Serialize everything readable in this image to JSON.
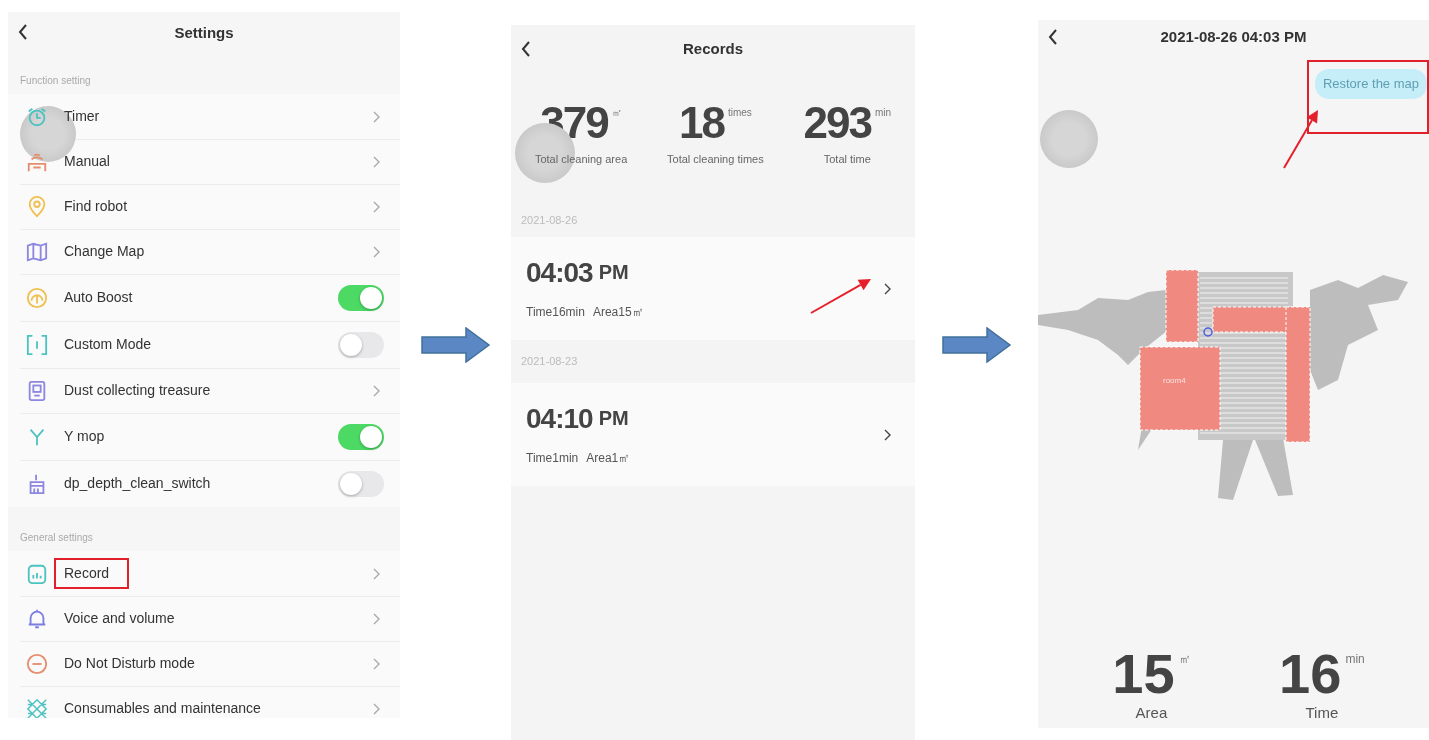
{
  "settings": {
    "title": "Settings",
    "sections": [
      {
        "header": "Function setting",
        "items": [
          {
            "label": "Timer",
            "kind": "link",
            "highlighted": false
          },
          {
            "label": "Manual",
            "kind": "link",
            "highlighted": false
          },
          {
            "label": "Find robot",
            "kind": "link",
            "highlighted": false
          },
          {
            "label": "Change Map",
            "kind": "link",
            "highlighted": false
          },
          {
            "label": "Auto Boost",
            "kind": "toggle",
            "on": true,
            "highlighted": false
          },
          {
            "label": "Custom Mode",
            "kind": "toggle",
            "on": false,
            "highlighted": false
          },
          {
            "label": "Dust collecting treasure",
            "kind": "link",
            "highlighted": false
          },
          {
            "label": "Y mop",
            "kind": "toggle",
            "on": true,
            "highlighted": false
          },
          {
            "label": "dp_depth_clean_switch",
            "kind": "toggle",
            "on": false,
            "highlighted": false
          }
        ]
      },
      {
        "header": "General settings",
        "items": [
          {
            "label": "Record",
            "kind": "link",
            "highlighted": true
          },
          {
            "label": "Voice and volume",
            "kind": "link",
            "highlighted": false
          },
          {
            "label": "Do Not Disturb mode",
            "kind": "link",
            "highlighted": false
          },
          {
            "label": "Consumables and maintenance",
            "kind": "link",
            "highlighted": false
          }
        ]
      }
    ]
  },
  "records": {
    "title": "Records",
    "stats": [
      {
        "value": "379",
        "unit": "㎡",
        "label": "Total cleaning area"
      },
      {
        "value": "18",
        "unit": "times",
        "label": "Total cleaning times"
      },
      {
        "value": "293",
        "unit": "min",
        "label": "Total time"
      }
    ],
    "entries": [
      {
        "date": "2021-08-26",
        "time": "04:03",
        "period": "PM",
        "duration": "Time16min",
        "area": "Area15㎡",
        "pointed": true
      },
      {
        "date": "2021-08-23",
        "time": "04:10",
        "period": "PM",
        "duration": "Time1min",
        "area": "Area1㎡",
        "pointed": false
      }
    ]
  },
  "record_detail": {
    "title": "2021-08-26 04:03 PM",
    "restore_button": {
      "label": "Restore the map",
      "disabled": true,
      "highlighted": true
    },
    "map": {
      "room_label": "room4"
    },
    "stats": [
      {
        "value": "15",
        "unit": "㎡",
        "label": "Area"
      },
      {
        "value": "16",
        "unit": "min",
        "label": "Time"
      }
    ]
  }
}
